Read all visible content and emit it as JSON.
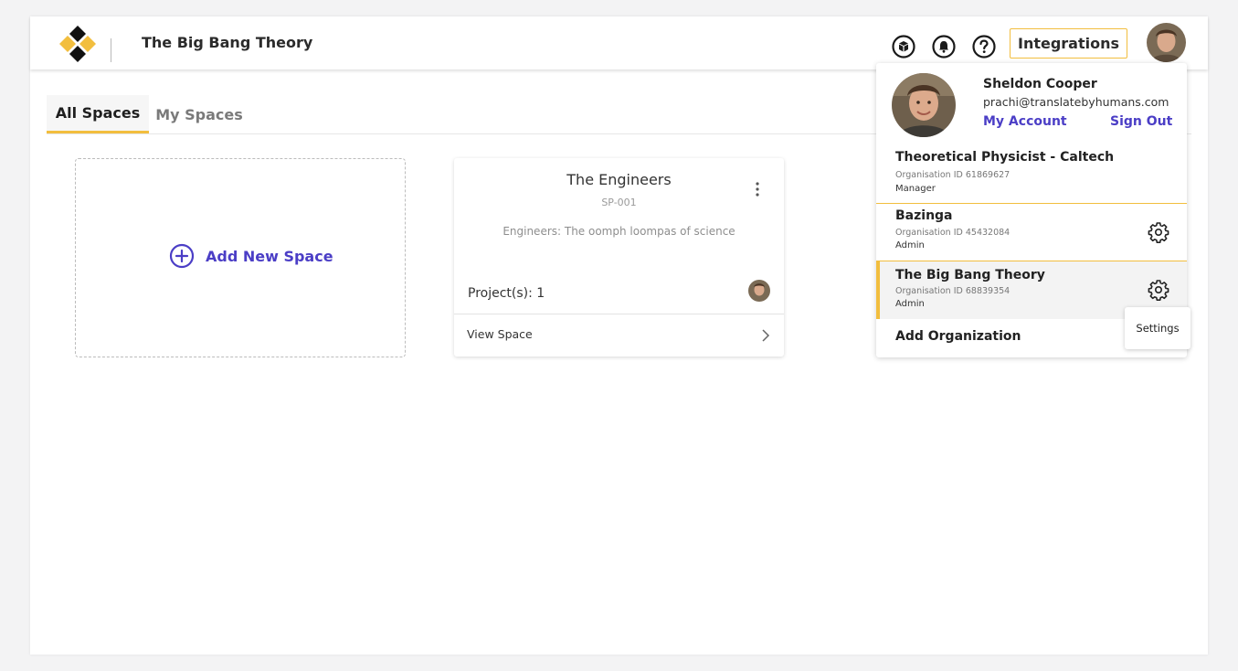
{
  "header": {
    "org_title": "The Big Bang Theory",
    "integrations_label": "Integrations",
    "icons": [
      "box-icon",
      "bell-icon",
      "help-icon"
    ]
  },
  "tabs": [
    {
      "label": "All Spaces",
      "active": true
    },
    {
      "label": "My Spaces",
      "active": false
    }
  ],
  "add_space": {
    "label": "Add New Space"
  },
  "space_card": {
    "title": "The Engineers",
    "code": "SP-001",
    "description": "Engineers: The oomph loompas of science",
    "projects": "Project(s): 1",
    "view_label": "View Space"
  },
  "account_menu": {
    "name": "Sheldon Cooper",
    "email": "prachi@translatebyhumans.com",
    "my_account": "My Account",
    "sign_out": "Sign Out",
    "organizations": [
      {
        "name": "Theoretical Physicist - Caltech",
        "org_id": "Organisation ID 61869627",
        "role": "Manager"
      },
      {
        "name": "Bazinga",
        "org_id": "Organisation ID 45432084",
        "role": "Admin"
      },
      {
        "name": "The Big Bang Theory",
        "org_id": "Organisation ID 68839354",
        "role": "Admin"
      }
    ],
    "add_org": "Add Organization",
    "tooltip": "Settings"
  },
  "colors": {
    "accent_yellow": "#f2be3e",
    "link_purple": "#4b3ec6"
  }
}
